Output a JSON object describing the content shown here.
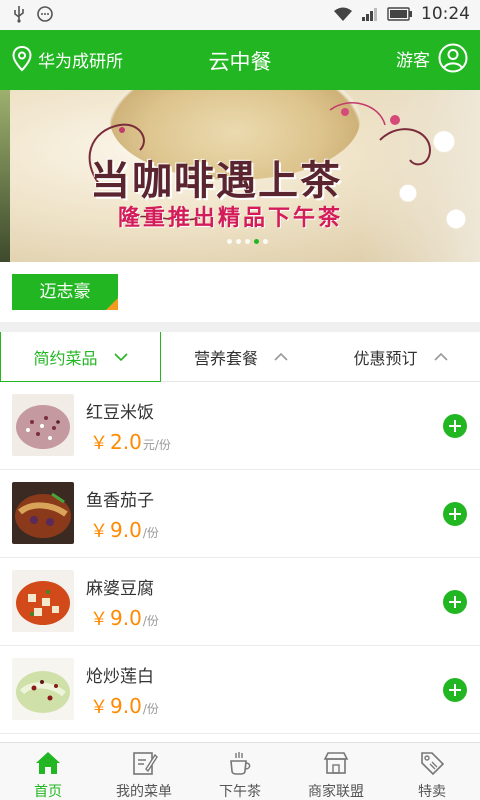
{
  "status_bar": {
    "time": "10:24"
  },
  "header": {
    "location": "华为成研所",
    "title": "云中餐",
    "user": "游客"
  },
  "banner": {
    "headline": "当咖啡遇上茶",
    "subline": "隆重推出精品下午茶"
  },
  "store": {
    "name": "迈志豪"
  },
  "tabs": [
    {
      "label": "简约菜品"
    },
    {
      "label": "营养套餐"
    },
    {
      "label": "优惠预订"
    }
  ],
  "dishes": [
    {
      "name": "红豆米饭",
      "currency": "￥",
      "price": "2.0",
      "unit": "元/份"
    },
    {
      "name": "鱼香茄子",
      "currency": "￥",
      "price": "9.0",
      "unit": "/份"
    },
    {
      "name": "麻婆豆腐",
      "currency": "￥",
      "price": "9.0",
      "unit": "/份"
    },
    {
      "name": "炝炒莲白",
      "currency": "￥",
      "price": "9.0",
      "unit": "/份"
    }
  ],
  "bottom_nav": [
    {
      "label": "首页"
    },
    {
      "label": "我的菜单"
    },
    {
      "label": "下午茶"
    },
    {
      "label": "商家联盟"
    },
    {
      "label": "特卖"
    }
  ],
  "colors": {
    "brand_green": "#22b722",
    "price_orange": "#ff8a00",
    "corner_orange": "#f39a1f"
  }
}
